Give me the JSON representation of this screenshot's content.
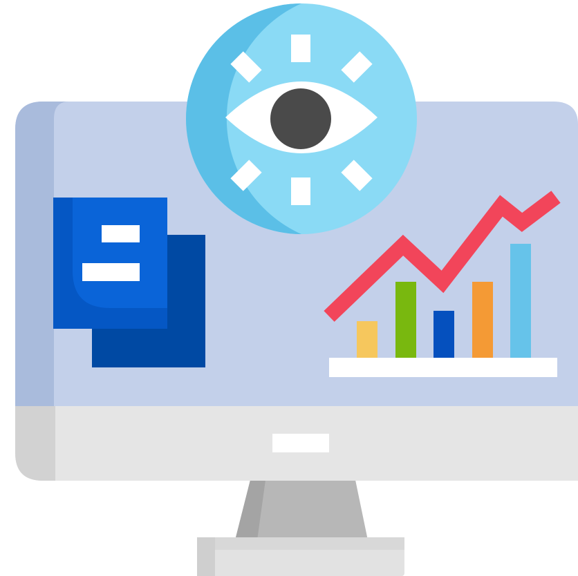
{
  "illustration": {
    "icon": "monitoring-analytics-icon",
    "colors": {
      "screen": "#c3d0ea",
      "screen_shadow": "#a9bbdc",
      "bezel": "#e5e5e5",
      "bezel_shadow": "#d2d2d2",
      "stand": "#b7b7b7",
      "stand_shadow": "#a4a4a4",
      "base": "#e2e2e2",
      "base_shadow": "#cfcfcf",
      "eye_circle": "#8adaf5",
      "eye_circle_shadow": "#5bbfe7",
      "eye_white": "#ffffff",
      "pupil": "#4a4a4a",
      "doc_front": "#0a64d8",
      "doc_back": "#0049a3",
      "trend_line": "#f2455a",
      "chart_baseline": "#ffffff"
    },
    "bars": [
      {
        "level": 0.33,
        "color": "#f6c75d"
      },
      {
        "level": 0.67,
        "color": "#79b80f"
      },
      {
        "level": 0.42,
        "color": "#0550be"
      },
      {
        "level": 0.67,
        "color": "#f49a35"
      },
      {
        "level": 1.0,
        "color": "#66c3ea"
      }
    ]
  }
}
